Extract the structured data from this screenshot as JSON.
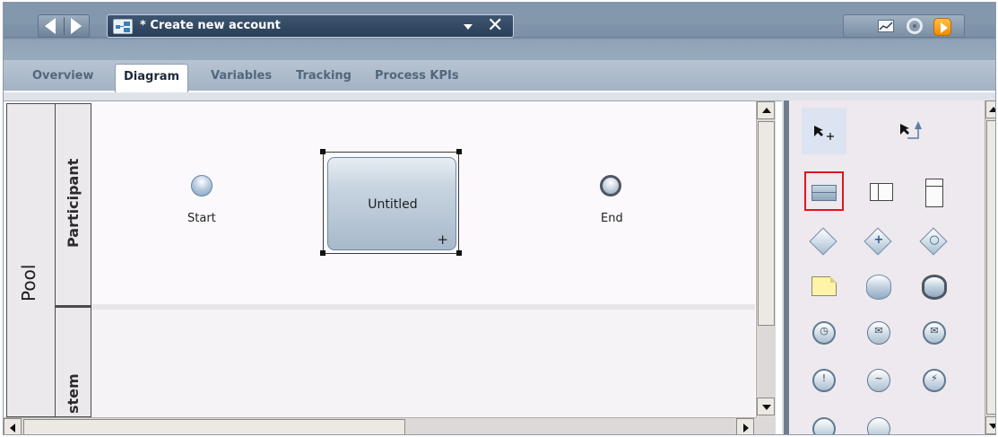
{
  "window": {
    "title": "* Create new account"
  },
  "tabs": [
    "Overview",
    "Diagram",
    "Variables",
    "Tracking",
    "Process KPIs"
  ],
  "active_tab": "Diagram",
  "diagram": {
    "pool_label": "Pool",
    "lanes": [
      "Participant",
      "System"
    ],
    "lane2_visible_text": "stem",
    "start_label": "Start",
    "task_label": "Untitled",
    "task_marker": "+",
    "end_label": "End"
  },
  "palette": {
    "tools": [
      "select-move-tool",
      "connect-tool"
    ],
    "items": [
      "lane-icon",
      "pool-icon",
      "column-icon",
      "gateway-icon",
      "parallel-gateway-icon",
      "inclusive-gateway-icon",
      "note-icon",
      "start-event-icon",
      "end-event-icon",
      "timer-event-icon",
      "message-event-icon",
      "message-end-icon",
      "signal-event-icon",
      "link-event-icon",
      "error-event-icon"
    ],
    "highlighted_item": "lane-icon",
    "symbols": {
      "parallel": "+",
      "inclusive": "○",
      "timer": "◷",
      "message": "✉",
      "error": "⚡",
      "link": "~",
      "signal": "!"
    }
  },
  "colors": {
    "highlight_border": "#e0161b",
    "topbar": "#8397ad",
    "title_combo": "#2f4763",
    "run_button": "#f39200"
  }
}
